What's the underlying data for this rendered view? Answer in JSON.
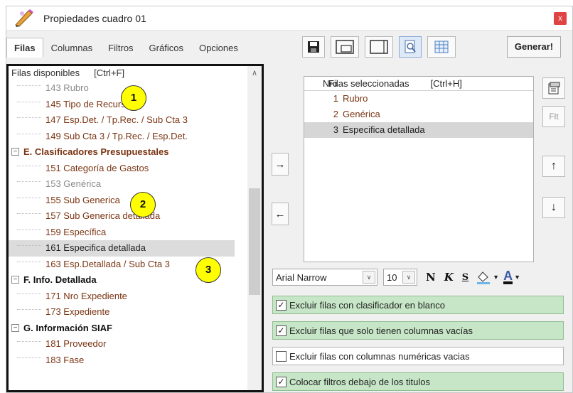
{
  "window": {
    "title": "Propiedades cuadro 01",
    "close_label": "x"
  },
  "tabs": [
    {
      "label": "Filas",
      "active": true
    },
    {
      "label": "Columnas"
    },
    {
      "label": "Filtros"
    },
    {
      "label": "Gráficos"
    },
    {
      "label": "Opciones"
    }
  ],
  "toolbar": {
    "generate_label": "Generar!",
    "icons": [
      "save-icon",
      "window-layout-icon",
      "panel-icon",
      "preview-icon",
      "grid-icon"
    ]
  },
  "left_panel": {
    "header": "Filas disponibles",
    "shortcut": "[Ctrl+F]",
    "rows": [
      {
        "type": "leaf",
        "label": "143 Rubro",
        "dim": true
      },
      {
        "type": "leaf",
        "label": "145 Tipo de Recurso"
      },
      {
        "type": "leaf",
        "label": "147 Esp.Det. / Tp.Rec. / Sub Cta 3"
      },
      {
        "type": "leaf",
        "label": "149 Sub Cta 3 / Tp.Rec. / Esp.Det."
      },
      {
        "type": "group",
        "label": "E. Clasificadores Presupuestales",
        "brown": true
      },
      {
        "type": "leaf",
        "label": "151 Categoría de Gastos"
      },
      {
        "type": "leaf",
        "label": "153 Genérica",
        "dim": true
      },
      {
        "type": "leaf",
        "label": "155 Sub Generica"
      },
      {
        "type": "leaf",
        "label": "157 Sub Generica detallada"
      },
      {
        "type": "leaf",
        "label": "159 Específica"
      },
      {
        "type": "leaf",
        "label": "161 Especifica detallada",
        "selected": true
      },
      {
        "type": "leaf",
        "label": "163 Esp.Detallada / Sub Cta 3"
      },
      {
        "type": "group",
        "label": "F. Info. Detallada"
      },
      {
        "type": "leaf",
        "label": "171 Nro Expediente"
      },
      {
        "type": "leaf",
        "label": "173 Expediente"
      },
      {
        "type": "group",
        "label": "G. Información SIAF"
      },
      {
        "type": "leaf",
        "label": "181 Proveedor"
      },
      {
        "type": "leaf",
        "label": "183 Fase"
      }
    ]
  },
  "right_list": {
    "col_nro": "Nro",
    "col_title": "Filas seleccionadas",
    "shortcut": "[Ctrl+H]",
    "rows": [
      {
        "n": "1",
        "label": "Rubro"
      },
      {
        "n": "2",
        "label": "Genérica"
      },
      {
        "n": "3",
        "label": "Especifica detallada",
        "selected": true
      }
    ]
  },
  "move": {
    "right_arrow": "→",
    "left_arrow": "←"
  },
  "side": {
    "flt_label": "Flt",
    "up_arrow": "↑",
    "down_arrow": "↓"
  },
  "font_bar": {
    "font_name": "Arial Narrow",
    "font_size": "10",
    "bold_label": "N",
    "italic_label": "K",
    "strike_label": "S",
    "fill_icon": "fill-color-icon",
    "font_color_label": "A"
  },
  "options": [
    {
      "label": "Excluir filas con clasificador en blanco",
      "checked": true
    },
    {
      "label": "Excluir filas que solo tienen columnas vacías",
      "checked": true
    },
    {
      "label": "Excluir filas con columnas numéricas vacias",
      "checked": false
    },
    {
      "label": "Colocar filtros debajo de los titulos",
      "checked": true
    }
  ],
  "annotations": [
    "1",
    "2",
    "3"
  ],
  "colors": {
    "accent_green": "#c7e6c7",
    "leaf_text": "#7a3412",
    "badge": "#ffff00",
    "close": "#e04343"
  }
}
